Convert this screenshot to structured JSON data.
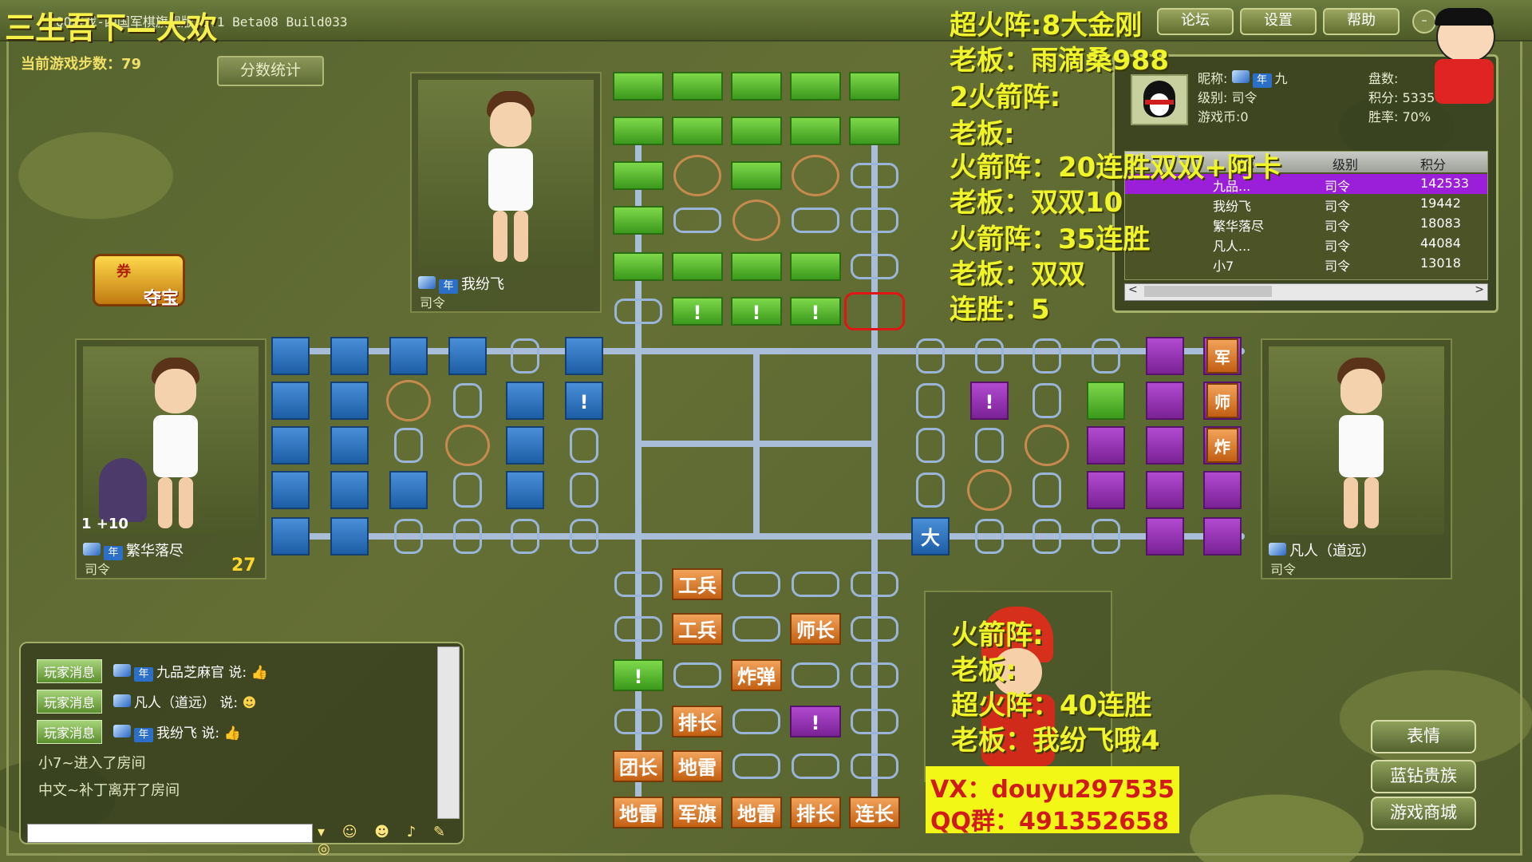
{
  "window": {
    "title": "QQ游戏-四国军棋旗舰版 2.1 Beta08 Build033",
    "overlay_title": "三生吾下—大欢",
    "buttons": [
      "论坛",
      "设置",
      "帮助"
    ]
  },
  "status": {
    "steps_label": "当前游戏步数：79",
    "score_button": "分数统计",
    "treasure_label": "夺宝",
    "treasure_glyph": "券"
  },
  "players": {
    "top": {
      "name": "我纷飞",
      "rank": "司令",
      "badge": "年"
    },
    "left": {
      "name": "繁华落尽",
      "rank": "司令",
      "badge": "年",
      "timer": "27",
      "bonus": "1 +10"
    },
    "right": {
      "name": "凡人（道远）",
      "rank": "司令"
    }
  },
  "info": {
    "nick_label": "昵称:",
    "nick_badge": "年",
    "nick_value": "九",
    "level": "级别: 司令",
    "coins": "游戏币:0",
    "games_label": "盘数:",
    "points_label": "积分:",
    "points_value": "53356",
    "winrate": "胜率: 70%",
    "table_headers": [
      "昵称",
      "级别",
      "积分"
    ],
    "rows": [
      {
        "name": "九品...",
        "level": "司令",
        "score": "142533",
        "badges": "年"
      },
      {
        "name": "我纷飞",
        "level": "司令",
        "score": "19442",
        "badges": "年"
      },
      {
        "name": "繁华落尽",
        "level": "司令",
        "score": "18083",
        "badges": "年"
      },
      {
        "name": "凡人...",
        "level": "司令",
        "score": "44084",
        "badges": ""
      },
      {
        "name": "小7",
        "level": "司令",
        "score": "13018",
        "badges": ""
      }
    ]
  },
  "overlay_lines": [
    "超火阵:8大金刚",
    "老板：雨滴桑988",
    "2火箭阵:",
    "老板:",
    "火箭阵：20连胜双双+阿卡",
    "老板：双双10",
    "火箭阵：35连胜",
    "老板：双双",
    "连胜：5"
  ],
  "bottom_overlay": [
    "火箭阵:",
    "老板:",
    "超火阵：40连胜",
    "老板：我纷飞哦4"
  ],
  "promo": {
    "vx": "VX：douyu297535",
    "qq": "QQ群：491352658"
  },
  "side_buttons": [
    "表情",
    "蓝钻贵族",
    "游戏商城"
  ],
  "chat": {
    "tag": "玩家消息",
    "messages": [
      {
        "user": "九品芝麻官",
        "said": "说:"
      },
      {
        "user": "凡人（道远）",
        "said": "说:"
      },
      {
        "user": "我纷飞",
        "said": "说:"
      }
    ],
    "system": [
      "小7~进入了房间",
      "中文~补丁离开了房间"
    ]
  },
  "board": {
    "bottom_pieces": [
      "工兵",
      "工兵",
      "师长",
      "炸弹",
      "排长",
      "团长",
      "地雷",
      "地雷",
      "军旗",
      "地雷",
      "排长",
      "连长"
    ],
    "right_labels": [
      "军",
      "师",
      "炸"
    ],
    "mid_piece": "大",
    "hidden_mark": "!"
  },
  "colors": {
    "green": "#4fb52a",
    "blue": "#2a6fc0",
    "purple": "#8f2ab0",
    "orange": "#e07b2a",
    "overlay": "#f0f52a"
  }
}
